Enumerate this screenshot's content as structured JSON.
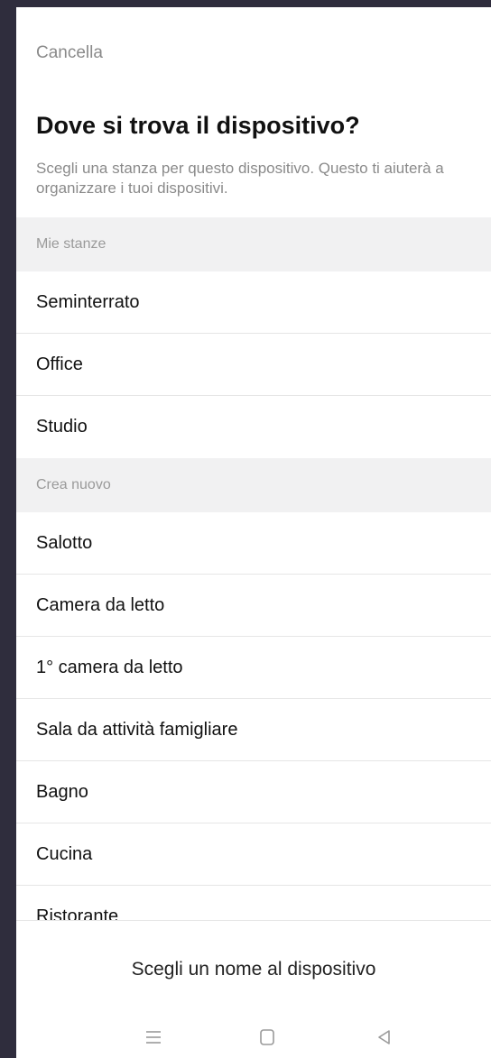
{
  "header": {
    "cancel_label": "Cancella",
    "title": "Dove si trova il dispositivo?",
    "subtitle": "Scegli una stanza per questo dispositivo. Questo ti aiuterà a organizzare i tuoi dispositivi."
  },
  "sections": [
    {
      "label": "Mie stanze",
      "items": [
        "Seminterrato",
        "Office",
        "Studio"
      ]
    },
    {
      "label": "Crea nuovo",
      "items": [
        "Salotto",
        "Camera da letto",
        "1° camera da letto",
        "Sala da attività famigliare",
        "Bagno",
        "Cucina",
        "Ristorante"
      ]
    }
  ],
  "footer": {
    "cta_label": "Scegli un nome al dispositivo"
  },
  "nav": {
    "icons": [
      "menu-icon",
      "home-icon",
      "back-icon"
    ]
  },
  "colors": {
    "background_frame": "#2f2d3d",
    "section_header_bg": "#f1f1f2",
    "muted_text": "#8a8a8a"
  }
}
